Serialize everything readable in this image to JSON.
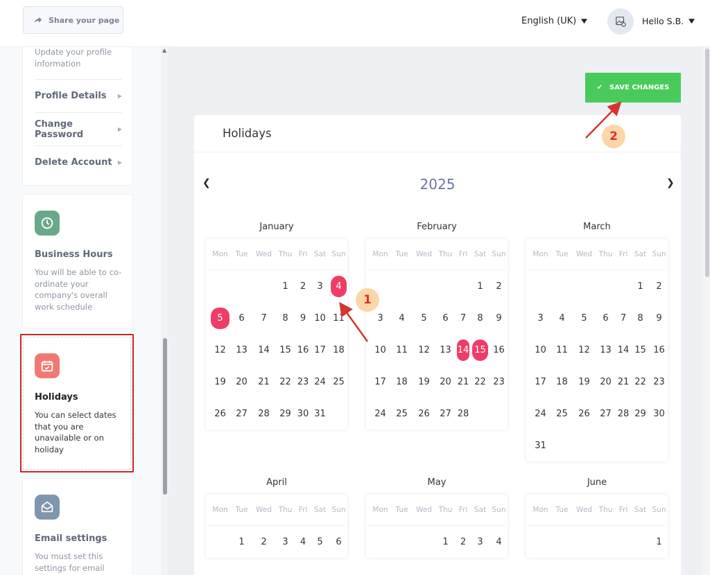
{
  "header": {
    "share_label": "Share your page",
    "language": "English (UK)",
    "user": "Hello S.B."
  },
  "sidebar": {
    "profile_desc": "Update your profile information",
    "menu": [
      {
        "label": "Profile Details"
      },
      {
        "label": "Change Password"
      },
      {
        "label": "Delete Account"
      }
    ],
    "cards": [
      {
        "title": "Business Hours",
        "desc": "You will be able to co-ordinate your company's overall work schedule",
        "icon": "clock-icon"
      },
      {
        "title": "Holidays",
        "desc": "You can select dates that you are unavailable or on holiday",
        "icon": "calendar-icon"
      },
      {
        "title": "Email settings",
        "desc": "You must set this settings for email",
        "icon": "envelope-icon"
      }
    ]
  },
  "main": {
    "save_label": "SAVE CHANGES",
    "panel_title": "Holidays",
    "year": "2025",
    "weekdays": [
      "Mon",
      "Tue",
      "Wed",
      "Thu",
      "Fri",
      "Sat",
      "Sun"
    ],
    "months": [
      {
        "name": "January",
        "offset": 3,
        "days": 31,
        "selected": [
          4,
          5
        ]
      },
      {
        "name": "February",
        "offset": 5,
        "days": 28,
        "selected": [
          14,
          15
        ]
      },
      {
        "name": "March",
        "offset": 5,
        "days": 31,
        "selected": []
      },
      {
        "name": "April",
        "offset": 1,
        "days": 6,
        "selected": []
      },
      {
        "name": "May",
        "offset": 3,
        "days": 4,
        "selected": []
      },
      {
        "name": "June",
        "offset": 6,
        "days": 1,
        "selected": []
      }
    ]
  },
  "annotations": {
    "step1": "1",
    "step2": "2"
  },
  "colors": {
    "accent": "#ee3e68",
    "save": "#49cb5b",
    "highlight": "#c62828",
    "year": "#6a73a3"
  }
}
